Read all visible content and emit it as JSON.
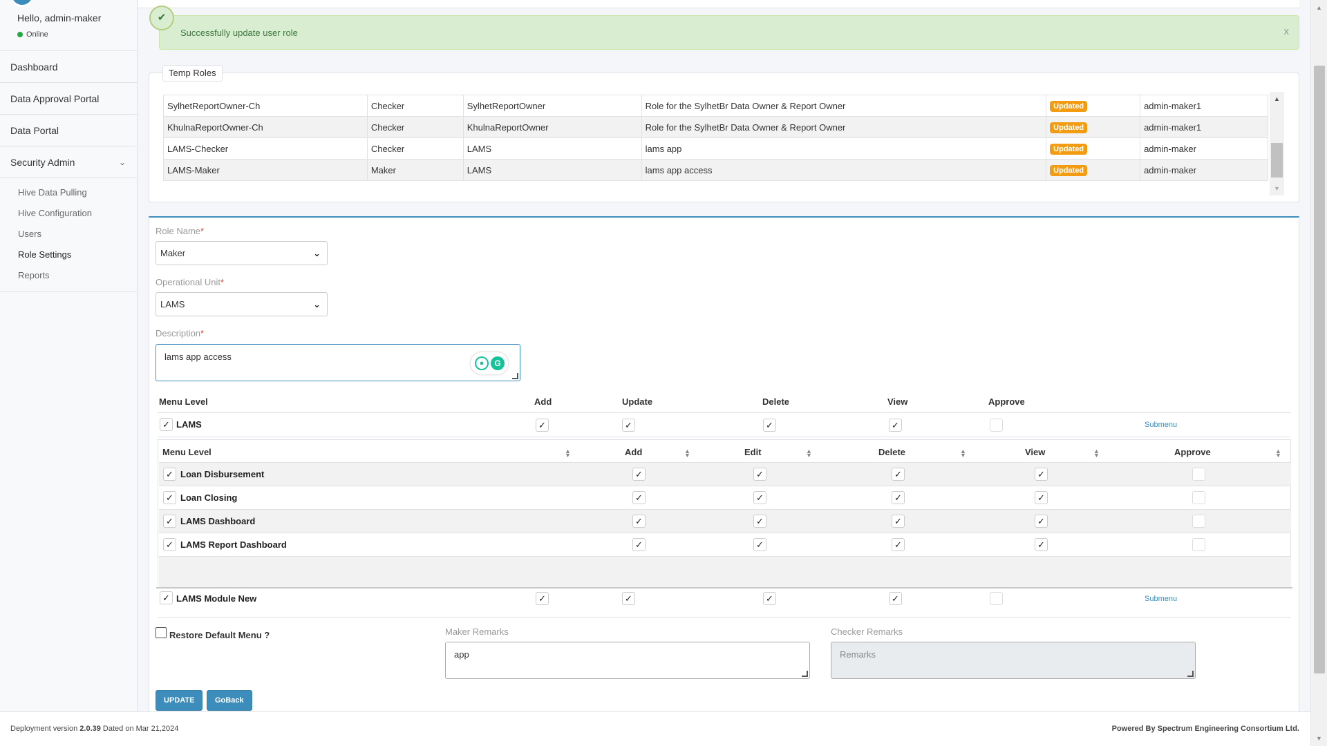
{
  "sidebar": {
    "greeting": "Hello, admin-maker",
    "status": "Online",
    "items": [
      {
        "label": "Dashboard"
      },
      {
        "label": "Data Approval Portal"
      },
      {
        "label": "Data Portal"
      },
      {
        "label": "Security Admin"
      }
    ],
    "submenu": [
      "Hive Data Pulling",
      "Hive Configuration",
      "Users",
      "Role Settings",
      "Reports"
    ]
  },
  "alert": {
    "message": "Successfully update user role",
    "close": "x"
  },
  "temp_roles": {
    "label": "Temp Roles",
    "rows": [
      {
        "name": "SylhetReportOwner-Ch",
        "type": "Checker",
        "unit": "SylhetReportOwner",
        "desc": "Role for the SylhetBr Data Owner & Report Owner",
        "status": "Updated",
        "user": "admin-maker1"
      },
      {
        "name": "KhulnaReportOwner-Ch",
        "type": "Checker",
        "unit": "KhulnaReportOwner",
        "desc": "Role for the SylhetBr Data Owner & Report Owner",
        "status": "Updated",
        "user": "admin-maker1"
      },
      {
        "name": "LAMS-Checker",
        "type": "Checker",
        "unit": "LAMS",
        "desc": "lams app",
        "status": "Updated",
        "user": "admin-maker"
      },
      {
        "name": "LAMS-Maker",
        "type": "Maker",
        "unit": "LAMS",
        "desc": "lams app access",
        "status": "Updated",
        "user": "admin-maker"
      }
    ]
  },
  "form": {
    "role_name_label": "Role Name",
    "role_name_value": "Maker",
    "op_unit_label": "Operational Unit",
    "op_unit_value": "LAMS",
    "desc_label": "Description",
    "desc_value": "lams app access",
    "required": "*"
  },
  "menu": {
    "headers": {
      "menu_level": "Menu Level",
      "add": "Add",
      "update": "Update",
      "delete": "Delete",
      "view": "View",
      "approve": "Approve"
    },
    "modules": [
      {
        "label": "LAMS",
        "submenu_link": "Submenu"
      },
      {
        "label": "LAMS Module New",
        "submenu_link": "Submenu"
      }
    ],
    "sub_headers": {
      "menu_level": "Menu Level",
      "add": "Add",
      "edit": "Edit",
      "delete": "Delete",
      "view": "View",
      "approve": "Approve"
    },
    "sub_rows": [
      "Loan Disbursement",
      "Loan Closing",
      "LAMS Dashboard",
      "LAMS Report Dashboard"
    ]
  },
  "restore": {
    "label": "Restore Default Menu ?"
  },
  "remarks": {
    "maker_label": "Maker Remarks",
    "maker_value": "app",
    "checker_label": "Checker Remarks",
    "checker_placeholder": "Remarks"
  },
  "buttons": {
    "update": "UPDATE",
    "goback": "GoBack"
  },
  "footer": {
    "left_prefix": "Deployment version ",
    "version": "2.0.39",
    "left_suffix": " Dated on Mar 21,2024",
    "right": "Powered By Spectrum Engineering Consortium Ltd."
  },
  "icons": {
    "check": "check-icon",
    "chevron": "chevron-down-icon",
    "sort": "sort-icon"
  },
  "colors": {
    "primary": "#3c8dbc",
    "badge": "#f39c12",
    "success_bg": "#d9eed0",
    "online": "#28a745"
  }
}
